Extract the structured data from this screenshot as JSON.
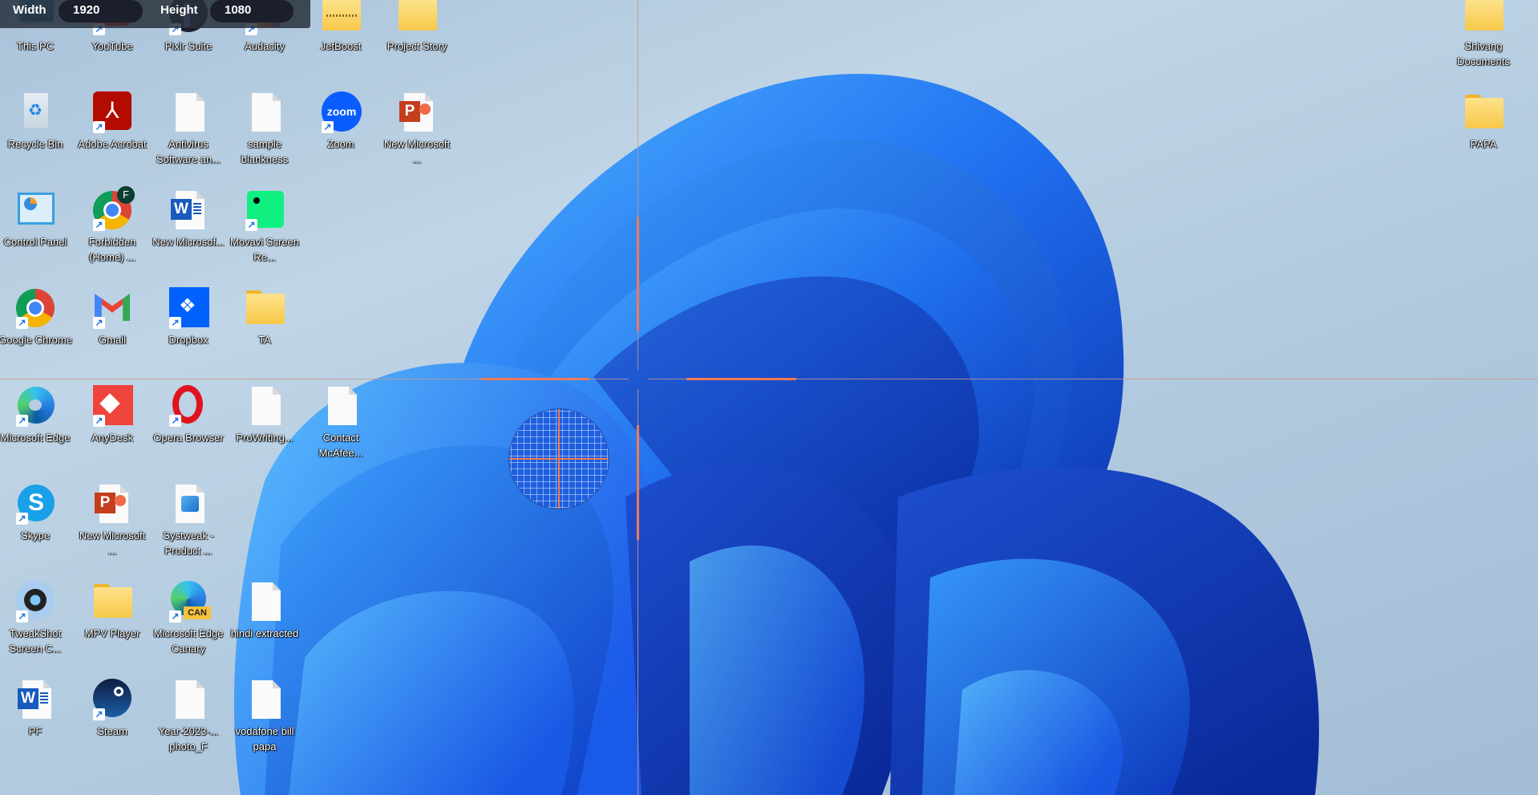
{
  "measure_bar": {
    "width_label": "Width",
    "width_value": "1920",
    "height_label": "Height",
    "height_value": "1080"
  },
  "desktop_icons": [
    {
      "label": "This PC",
      "icon": "this-pc-icon"
    },
    {
      "label": "YouTube",
      "icon": "youtube-icon",
      "shortcut": true
    },
    {
      "label": "Pixlr Suite",
      "icon": "pixlr-icon",
      "shortcut": true
    },
    {
      "label": "Audacity",
      "icon": "audacity-icon",
      "shortcut": true
    },
    {
      "label": "JetBoost",
      "icon": "zip-folder-icon"
    },
    {
      "label": "Project Story",
      "icon": "folder-icon"
    },
    {
      "label": "Recycle Bin",
      "icon": "recycle-bin-icon"
    },
    {
      "label": "Adobe Acrobat",
      "icon": "acrobat-icon",
      "shortcut": true
    },
    {
      "label": "Antivirus Software an...",
      "icon": "file-icon"
    },
    {
      "label": "sample blankness",
      "icon": "file-icon"
    },
    {
      "label": "Zoom",
      "icon": "zoom-icon",
      "shortcut": true
    },
    {
      "label": "New Microsoft ...",
      "icon": "powerpoint-file-icon"
    },
    {
      "label": "Control Panel",
      "icon": "control-panel-icon"
    },
    {
      "label": "Forbidden (Home) ...",
      "icon": "chrome-profile-icon",
      "shortcut": true
    },
    {
      "label": "New Microsof...",
      "icon": "word-file-icon"
    },
    {
      "label": "Movavi Screen Re...",
      "icon": "movavi-icon",
      "shortcut": true
    },
    {
      "label": "Google Chrome",
      "icon": "chrome-icon",
      "shortcut": true
    },
    {
      "label": "Gmail",
      "icon": "gmail-icon",
      "shortcut": true
    },
    {
      "label": "Dropbox",
      "icon": "dropbox-icon",
      "shortcut": true
    },
    {
      "label": "TA",
      "icon": "folder-icon"
    },
    {
      "label": "Microsoft Edge",
      "icon": "edge-icon",
      "shortcut": true
    },
    {
      "label": "AnyDesk",
      "icon": "anydesk-icon",
      "shortcut": true
    },
    {
      "label": "Opera Browser",
      "icon": "opera-icon",
      "shortcut": true
    },
    {
      "label": "ProWriting...",
      "icon": "file-icon"
    },
    {
      "label": "Contact McAfee...",
      "icon": "file-icon"
    },
    {
      "label": "Skype",
      "icon": "skype-icon",
      "shortcut": true
    },
    {
      "label": "New Microsoft ...",
      "icon": "powerpoint-file-icon"
    },
    {
      "label": "Systweak - Product ...",
      "icon": "image-file-icon"
    },
    {
      "label": "TweakShot Screen C...",
      "icon": "tweakshot-icon",
      "shortcut": true
    },
    {
      "label": "MPV Player",
      "icon": "folder-icon"
    },
    {
      "label": "Microsoft Edge Canary",
      "icon": "edge-canary-icon",
      "shortcut": true
    },
    {
      "label": "hindi extracted",
      "icon": "file-icon"
    },
    {
      "label": "PF",
      "icon": "word-file-icon"
    },
    {
      "label": "Steam",
      "icon": "steam-icon",
      "shortcut": true
    },
    {
      "label": "Year-2023-... photo_F",
      "icon": "file-icon"
    },
    {
      "label": "vodafone bill papa",
      "icon": "file-icon"
    },
    {
      "label": "Shivang Documents",
      "icon": "folder-icon"
    },
    {
      "label": "PAPA",
      "icon": "folder-icon"
    }
  ],
  "colors": {
    "crosshair": "#f07a56",
    "accent_blue": "#1a73e8"
  }
}
